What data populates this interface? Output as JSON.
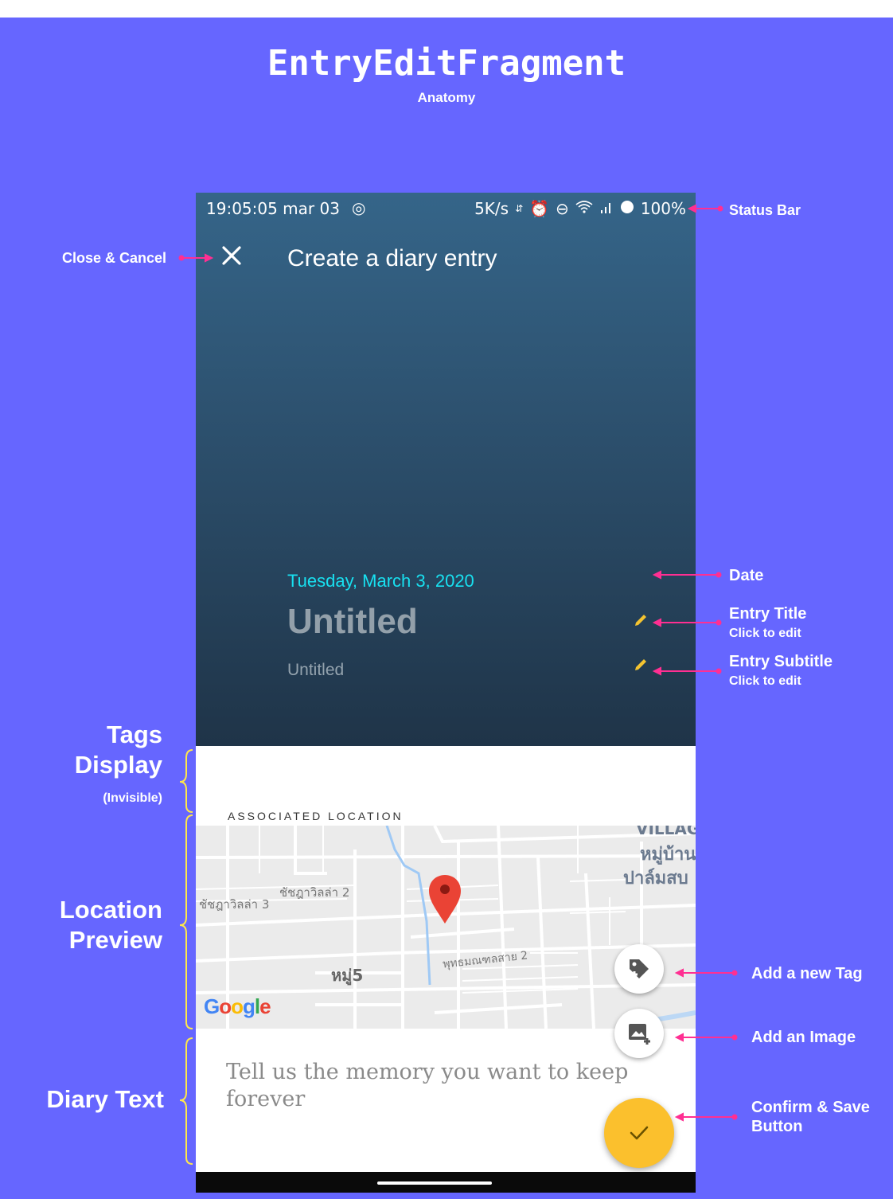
{
  "diagram": {
    "title": "EntryEditFragment",
    "subtitle": "Anatomy"
  },
  "status_bar": {
    "time": "19:05:05 mar 03",
    "speed": "5K/s",
    "battery": "100%"
  },
  "toolbar": {
    "close_icon": "close-icon",
    "title": "Create a diary entry"
  },
  "entry": {
    "date": "Tuesday, March 3, 2020",
    "title": "Untitled",
    "subtitle": "Untitled"
  },
  "location": {
    "label": "ASSOCIATED LOCATION",
    "map_labels": [
      "ชัชฎาวิลล่า 2",
      "ชัชฎาวิลล่า 3",
      "หมู่5",
      "พุทธมณฑลสาย 2",
      "VILLAG",
      "หมู่บ้าน",
      "ปาล์มสบ"
    ],
    "attribution": "Google"
  },
  "diary": {
    "placeholder": "Tell us the memory you want to keep forever"
  },
  "annotations": {
    "status_bar": "Status Bar",
    "close_cancel": "Close & Cancel",
    "date": "Date",
    "entry_title": "Entry Title",
    "entry_title_hint": "Click to edit",
    "entry_subtitle": "Entry Subtitle",
    "entry_subtitle_hint": "Click to edit",
    "tags_display_1": "Tags",
    "tags_display_2": "Display",
    "tags_invisible": "(Invisible)",
    "location_preview_1": "Location",
    "location_preview_2": "Preview",
    "diary_text": "Diary Text",
    "add_tag": "Add a new Tag",
    "add_image": "Add an Image",
    "confirm_save_1": "Confirm & Save",
    "confirm_save_2": "Button"
  },
  "colors": {
    "background": "#6666ff",
    "accent_date": "#18e0f0",
    "fab_confirm": "#fbc02d",
    "arrow": "#ff2f92",
    "bracket": "#ffe74a",
    "pin": "#ea4335"
  }
}
